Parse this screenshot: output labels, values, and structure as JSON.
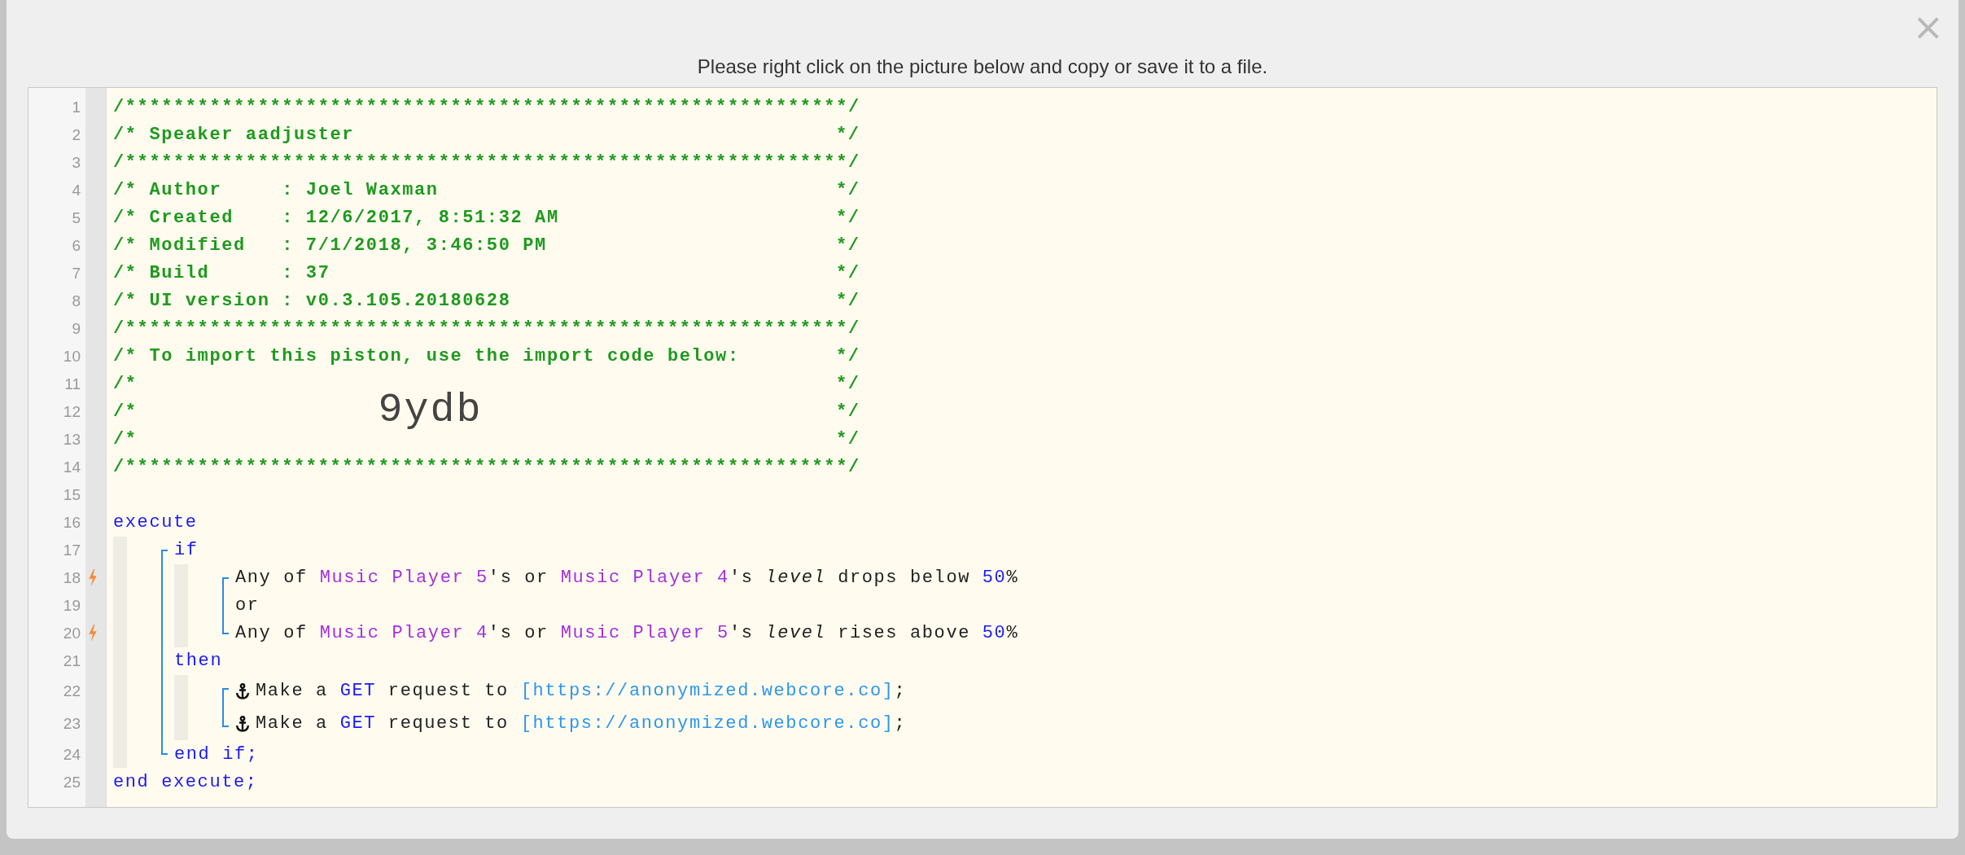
{
  "dialog": {
    "close": "×",
    "title": "Please right click on the picture below and copy or save it to a file."
  },
  "listing": {
    "lines": [
      {
        "number": "1",
        "trigger": false,
        "kind": "rule",
        "text": "/************************************************************/"
      },
      {
        "number": "2",
        "trigger": false,
        "kind": "comment",
        "text": "/* Speaker aadjuster",
        "end": "*/"
      },
      {
        "number": "3",
        "trigger": false,
        "kind": "rule",
        "text": "/************************************************************/"
      },
      {
        "number": "4",
        "trigger": false,
        "kind": "comment",
        "text": "/* Author     : Joel Waxman",
        "end": "*/"
      },
      {
        "number": "5",
        "trigger": false,
        "kind": "comment",
        "text": "/* Created    : 12/6/2017, 8:51:32 AM",
        "end": "*/"
      },
      {
        "number": "6",
        "trigger": false,
        "kind": "comment",
        "text": "/* Modified   : 7/1/2018, 3:46:50 PM",
        "end": "*/"
      },
      {
        "number": "7",
        "trigger": false,
        "kind": "comment",
        "text": "/* Build      : 37",
        "end": "*/"
      },
      {
        "number": "8",
        "trigger": false,
        "kind": "comment",
        "text": "/* UI version : v0.3.105.20180628",
        "end": "*/"
      },
      {
        "number": "9",
        "trigger": false,
        "kind": "rule",
        "text": "/************************************************************/"
      },
      {
        "number": "10",
        "trigger": false,
        "kind": "comment",
        "text": "/* To import this piston, use the import code below:",
        "end": "*/"
      },
      {
        "number": "11",
        "trigger": false,
        "kind": "comment",
        "text": "/*",
        "end": "*/"
      },
      {
        "number": "12",
        "trigger": false,
        "kind": "import",
        "text": "/*",
        "code": "9ydb",
        "end": "*/"
      },
      {
        "number": "13",
        "trigger": false,
        "kind": "comment",
        "text": "/*",
        "end": "*/"
      },
      {
        "number": "14",
        "trigger": false,
        "kind": "rule",
        "text": "/************************************************************/"
      },
      {
        "number": "15",
        "trigger": false,
        "kind": "blank"
      },
      {
        "number": "16",
        "trigger": false,
        "kind": "statement",
        "segments": [
          {
            "kind": "keyword",
            "text": "execute"
          }
        ],
        "children": [
          {
            "number": "17",
            "trigger": false,
            "kind": "statement",
            "segments": [
              {
                "kind": "keyword",
                "text": "if"
              }
            ],
            "children": [
              {
                "number": "18",
                "trigger": true,
                "kind": "statement",
                "segments": [
                  {
                    "kind": "plain",
                    "text": "Any of "
                  },
                  {
                    "kind": "device",
                    "text": "Music Player 5"
                  },
                  {
                    "kind": "plain",
                    "text": "'s or "
                  },
                  {
                    "kind": "device",
                    "text": "Music Player 4"
                  },
                  {
                    "kind": "plain",
                    "text": "'s "
                  },
                  {
                    "kind": "attribute",
                    "text": "level"
                  },
                  {
                    "kind": "plain",
                    "text": " drops below "
                  },
                  {
                    "kind": "number",
                    "text": "50"
                  },
                  {
                    "kind": "plain",
                    "text": "%"
                  }
                ]
              },
              {
                "number": "19",
                "trigger": false,
                "kind": "statement",
                "segments": [
                  {
                    "kind": "plain",
                    "text": "or"
                  }
                ]
              },
              {
                "number": "20",
                "trigger": true,
                "kind": "statement",
                "segments": [
                  {
                    "kind": "plain",
                    "text": "Any of "
                  },
                  {
                    "kind": "device",
                    "text": "Music Player 4"
                  },
                  {
                    "kind": "plain",
                    "text": "'s or "
                  },
                  {
                    "kind": "device",
                    "text": "Music Player 5"
                  },
                  {
                    "kind": "plain",
                    "text": "'s "
                  },
                  {
                    "kind": "attribute",
                    "text": "level"
                  },
                  {
                    "kind": "plain",
                    "text": " rises above "
                  },
                  {
                    "kind": "number",
                    "text": "50"
                  },
                  {
                    "kind": "plain",
                    "text": "%"
                  }
                ]
              }
            ]
          },
          {
            "number": "21",
            "trigger": false,
            "kind": "statement",
            "segments": [
              {
                "kind": "keyword",
                "text": "then"
              }
            ],
            "children": [
              {
                "number": "22",
                "trigger": false,
                "kind": "action",
                "segments": [
                  {
                    "kind": "plain",
                    "text": "Make a "
                  },
                  {
                    "kind": "keyword",
                    "text": "GET"
                  },
                  {
                    "kind": "plain",
                    "text": " request to "
                  },
                  {
                    "kind": "url",
                    "text": "[https://anonymized.webcore.co]"
                  },
                  {
                    "kind": "plain",
                    "text": ";"
                  }
                ]
              },
              {
                "number": "23",
                "trigger": false,
                "kind": "action",
                "segments": [
                  {
                    "kind": "plain",
                    "text": "Make a "
                  },
                  {
                    "kind": "keyword",
                    "text": "GET"
                  },
                  {
                    "kind": "plain",
                    "text": " request to "
                  },
                  {
                    "kind": "url",
                    "text": "[https://anonymized.webcore.co]"
                  },
                  {
                    "kind": "plain",
                    "text": ";"
                  }
                ]
              }
            ]
          },
          {
            "number": "24",
            "trigger": false,
            "kind": "statement",
            "segments": [
              {
                "kind": "keyword",
                "text": "end if;"
              }
            ]
          }
        ]
      },
      {
        "number": "25",
        "trigger": false,
        "kind": "statement",
        "segments": [
          {
            "kind": "keyword",
            "text": "end execute;"
          }
        ]
      }
    ]
  }
}
